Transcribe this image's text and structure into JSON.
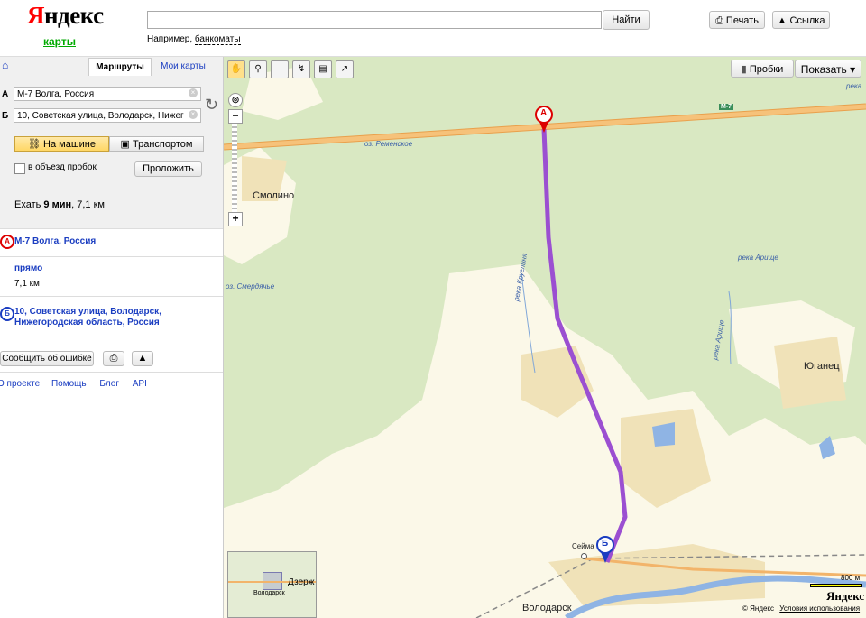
{
  "header": {
    "logo_main": "Яндекс",
    "logo_sub": "карты",
    "search_value": "",
    "search_button": "Найти",
    "hint_prefix": "Например, ",
    "hint_example": "банкоматы",
    "print_button": "Печать",
    "link_button": "Ссылка"
  },
  "panel": {
    "tabs": [
      "Маршруты",
      "Мои карты"
    ],
    "point_a_label": "А",
    "point_b_label": "Б",
    "point_a_value": "М-7 Волга, Россия",
    "point_b_value": "10, Советская улица, Володарск, Нижег",
    "mode_car": "На машине",
    "mode_transport": "Транспортом",
    "avoid_traffic": "в объезд пробок",
    "build_button": "Проложить",
    "summary_prefix": "Ехать ",
    "summary_time": "9 мин",
    "summary_dist": ", 7,1 км",
    "step_a_address": "М-7 Волга, Россия",
    "step_direction": "прямо",
    "step_distance": "7,1 км",
    "step_b_address_line1": "10, Советская улица, Володарск,",
    "step_b_address_line2": "Нижегородская область, Россия",
    "report_button": "Сообщить об ошибке",
    "footer_links": [
      "О проекте",
      "Помощь",
      "Блог",
      "API"
    ]
  },
  "map": {
    "traffic_button": "Пробки",
    "show_button": "Показать",
    "road_label": "М-7",
    "places": {
      "smolino": "Смолино",
      "yuganets": "Юганец",
      "volodarsk": "Володарск",
      "seima": "Сейма"
    },
    "rivers": {
      "remenskoe": "оз. Ременское",
      "smerdyache": "оз. Смердячье",
      "kruglovina": "река Круглиня",
      "arische": "река Арище",
      "arische2": "река Арище",
      "reka_top": "река"
    },
    "minimap": {
      "label1": "Дзерж",
      "label2": "Володарск"
    },
    "scale": "800 м",
    "copyright": "© Яндекс",
    "terms": "Условия использования",
    "brand": "Яндекс",
    "marker_a": "А",
    "marker_b": "Б",
    "colors": {
      "route": "#9b4fd1",
      "road": "#f2b46a",
      "forest": "#d9e8c2",
      "field": "#fbf8e8"
    }
  }
}
